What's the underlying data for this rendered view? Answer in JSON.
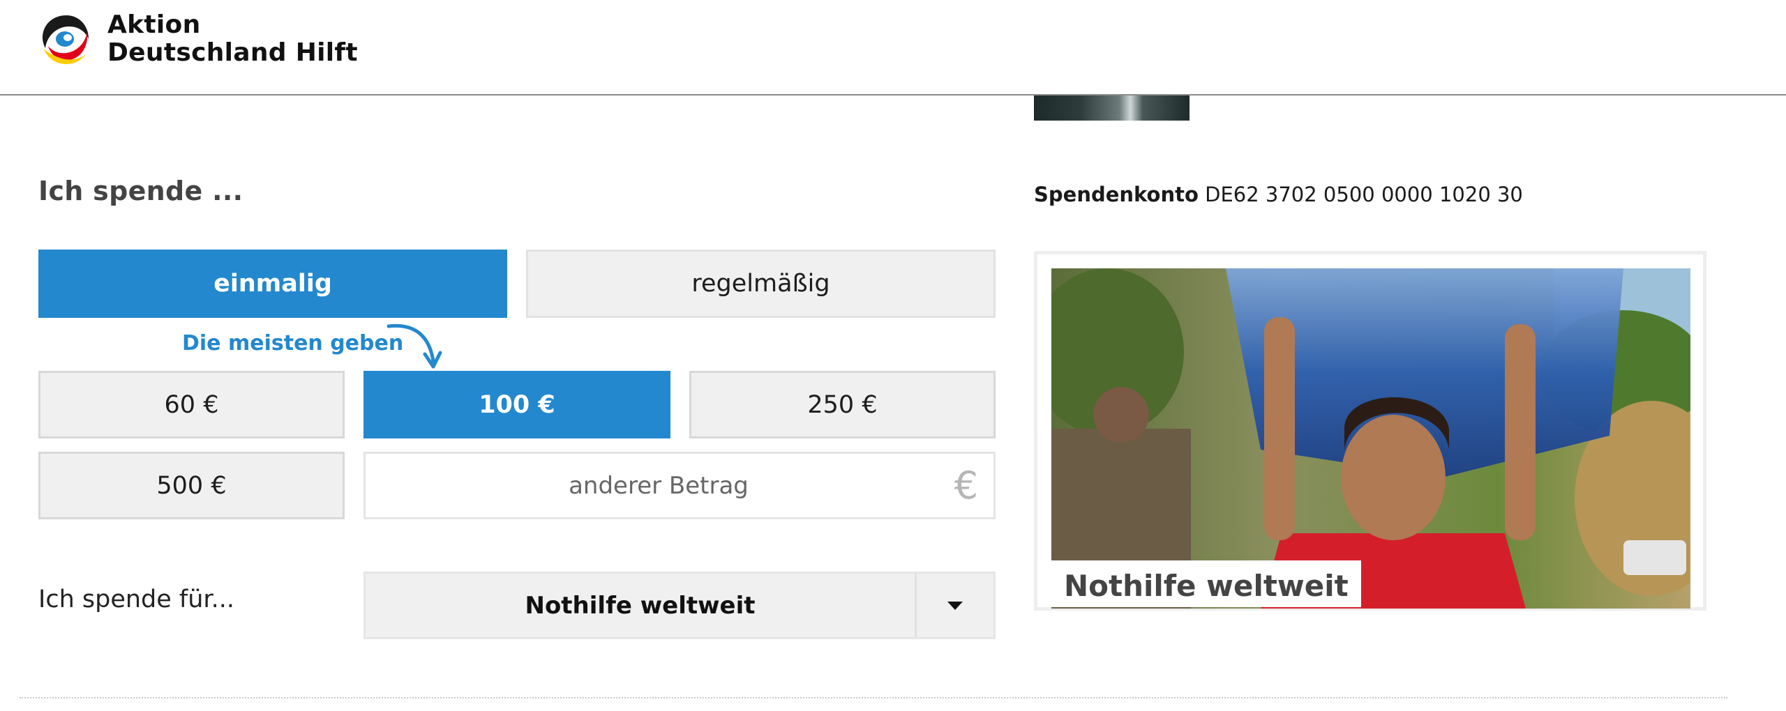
{
  "header": {
    "brand_line1": "Aktion",
    "brand_line2": "Deutschland Hilft",
    "logo_icon": "adh-swirl-logo"
  },
  "form": {
    "title": "Ich spende ...",
    "frequency": {
      "options": [
        "einmalig",
        "regelmäßig"
      ],
      "selected": "einmalig"
    },
    "hint": "Die meisten geben",
    "amounts": [
      "60 €",
      "100 €",
      "250 €",
      "500 €"
    ],
    "selected_amount": "100 €",
    "other_amount_placeholder": "anderer Betrag",
    "currency_symbol": "€",
    "purpose_label": "Ich spende für...",
    "purpose_value": "Nothilfe weltweit"
  },
  "sidebar": {
    "account_label": "Spendenkonto",
    "account_iban": "DE62 3702 0500 0000 1020 30",
    "card_caption": "Nothilfe weltweit"
  },
  "colors": {
    "accent": "#2388ce",
    "button_bg": "#f0f0f0",
    "text": "#1a1a1a"
  }
}
